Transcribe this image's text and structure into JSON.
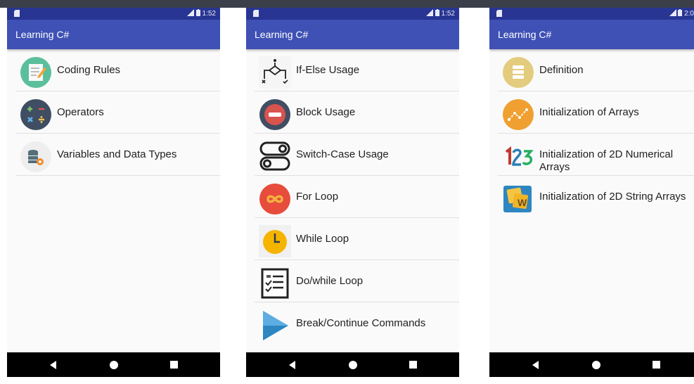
{
  "phones": [
    {
      "status_time": "1:52",
      "app_title": "Learning C#",
      "items": [
        {
          "label": "Coding Rules",
          "icon": "coding-rules-icon"
        },
        {
          "label": "Operators",
          "icon": "operators-icon"
        },
        {
          "label": "Variables and Data Types",
          "icon": "variables-icon"
        }
      ]
    },
    {
      "status_time": "1:52",
      "app_title": "Learning C#",
      "items": [
        {
          "label": "If-Else Usage",
          "icon": "if-else-icon"
        },
        {
          "label": "Block Usage",
          "icon": "block-icon"
        },
        {
          "label": "Switch-Case Usage",
          "icon": "switch-icon"
        },
        {
          "label": "For Loop",
          "icon": "infinity-icon"
        },
        {
          "label": "While Loop",
          "icon": "clock-icon"
        },
        {
          "label": "Do/while Loop",
          "icon": "checklist-icon"
        },
        {
          "label": "Break/Continue Commands",
          "icon": "play-icon"
        }
      ]
    },
    {
      "status_time": "2:0",
      "app_title": "Learning C#",
      "items": [
        {
          "label": "Definition",
          "icon": "definition-icon"
        },
        {
          "label": "Initialization of Arrays",
          "icon": "arrays-chart-icon"
        },
        {
          "label": "Initialization of 2D Numerical Arrays",
          "icon": "numbers-123-icon"
        },
        {
          "label": "Initialization of 2D String Arrays",
          "icon": "word-tiles-icon"
        }
      ]
    }
  ],
  "colors": {
    "status_bar": "#283593",
    "app_bar": "#3f51b5",
    "nav_bar": "#000000"
  }
}
